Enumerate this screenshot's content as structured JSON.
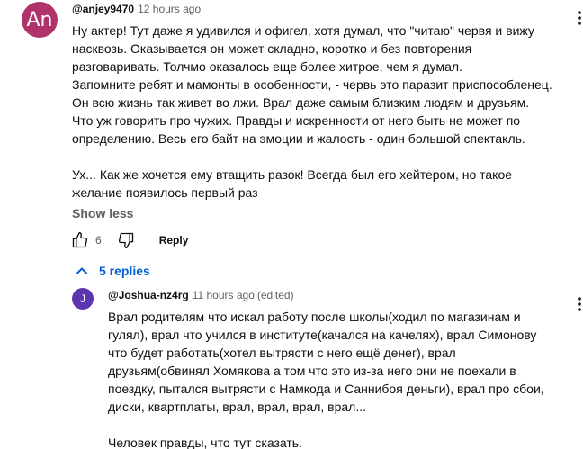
{
  "comment": {
    "avatar_letters": "An",
    "avatar_color": "#b0336b",
    "author": "@anjey9470",
    "time": "12 hours ago",
    "text": "Ну актер! Тут даже я удивился и офигел, хотя думал, что \"читаю\" червя и вижу\nнасквозь. Оказывается он может складно, коротко и без повторения\nразговаривать. Толчмо оказалось еще более хитрое, чем я думал.\nЗапомните ребят и мамонты в особенности, - червь это паразит приспособленец.\nОн всю жизнь так живет во лжи. Врал даже самым близким людям и друзьям.\nЧто уж говорить про чужих. Правды и искренности от него быть не может по\nопределению. Весь его байт на эмоции и жалость - один большой спектакль.\n\nУх... Как же хочется ему втащить разок! Всегда был его хейтером, но такое\nжелание появилось первый раз",
    "show_less": "Show less",
    "likes": "6",
    "reply_label": "Reply",
    "replies_label": "5 replies"
  },
  "reply": {
    "avatar_letter": "J",
    "avatar_color": "#5e35b1",
    "author": "@Joshua-nz4rg",
    "time": "11 hours ago",
    "edited": "(edited)",
    "text": "Врал родителям что искал работу после школы(ходил по магазинам и\nгулял), врал что учился в институте(качался на качелях), врал Симонову\nчто будет работать(хотел вытрясти с него ещё денег), врал\nдрузьям(обвинял Хомякова а том что это из-за него они не поехали в\nпоездку, пытался вытрясти с Намкода и Саннибоя деньги), врал про сбои,\nдиски, квартплаты, врал, врал, врал, врал...\n\nЧеловек правды, что тут сказать."
  },
  "colors": {
    "link": "#065fd4",
    "secondary_text": "#606060"
  },
  "icons": [
    "like-icon",
    "dislike-icon",
    "chevron-up-icon",
    "more-vert-icon"
  ]
}
